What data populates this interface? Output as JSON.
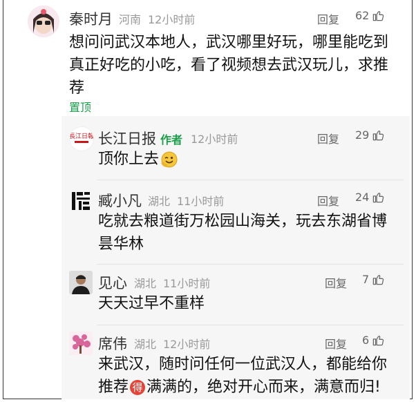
{
  "main_comment": {
    "user": "秦时月",
    "location": "河南",
    "time": "12小时前",
    "reply_label": "回复",
    "likes": "62",
    "content": "想问问武汉本地人，武汉哪里好玩，哪里能吃到真正好吃的小吃，看了视频想去武汉玩儿，求推荐",
    "pinned_label": "置顶"
  },
  "replies": [
    {
      "user": "长江日报",
      "author_label": "作者",
      "location": "",
      "time": "12小时前",
      "reply_label": "回复",
      "likes": "29",
      "content": "顶你上去"
    },
    {
      "user": "臧小凡",
      "location": "湖北",
      "time": "11小时前",
      "reply_label": "回复",
      "likes": "24",
      "content": "吃就去粮道街万松园山海关，玩去东湖省博昙华林"
    },
    {
      "user": "见心",
      "location": "湖北",
      "time": "11小时前",
      "reply_label": "回复",
      "likes": "7",
      "content": "天天过早不重样"
    },
    {
      "user": "席伟",
      "location": "湖北",
      "time": "12小时前",
      "reply_label": "回复",
      "likes": "6",
      "content_before": "来武汉，随时问任何一位武汉人，都能给你推荐",
      "badge": "得",
      "content_after": "满满的，绝对开心而来，满意而归!"
    }
  ],
  "colors": {
    "author_green": "#1a9e4a",
    "meta_gray": "#999999",
    "badge_red": "#e04538"
  },
  "icons": [
    "thumbs-up-icon",
    "wink-emoji-icon"
  ]
}
